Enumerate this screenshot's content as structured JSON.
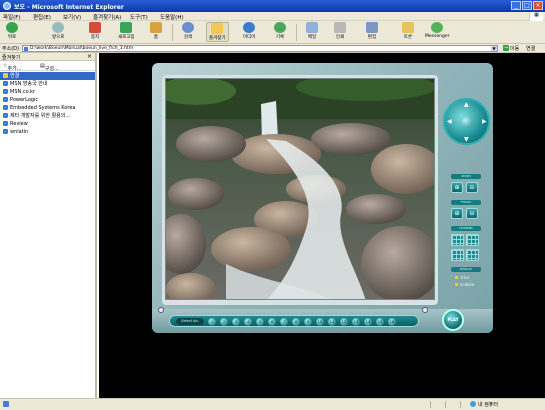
{
  "window": {
    "title": "보오 - Microsoft Internet Explorer"
  },
  "menu": [
    "파일(F)",
    "편집(E)",
    "보기(V)",
    "즐겨찾기(A)",
    "도구(T)",
    "도움말(H)"
  ],
  "toolbar": {
    "buttons": [
      {
        "label": "뒤로",
        "icon": "back-arrow-icon"
      },
      {
        "label": "앞으로",
        "icon": "forward-arrow-icon"
      },
      {
        "label": "중지",
        "icon": "stop-icon"
      },
      {
        "label": "새로고침",
        "icon": "refresh-icon"
      },
      {
        "label": "홈",
        "icon": "home-icon"
      },
      {
        "label": "검색",
        "icon": "search-icon"
      },
      {
        "label": "즐겨찾기",
        "icon": "favorites-star-icon"
      },
      {
        "label": "미디어",
        "icon": "media-icon"
      },
      {
        "label": "기록",
        "icon": "history-icon"
      },
      {
        "label": "메일",
        "icon": "mail-icon"
      },
      {
        "label": "인쇄",
        "icon": "print-icon"
      },
      {
        "label": "편집",
        "icon": "edit-icon"
      },
      {
        "label": "토론",
        "icon": "discuss-icon"
      },
      {
        "label": "Messenger",
        "icon": "messenger-icon"
      }
    ]
  },
  "address": {
    "label": "주소(D)",
    "url": "D:\\work\\Boeun\\Manual\\boeun_live_f\\ch_1.htm",
    "go_label": "이동",
    "links_label": "연결"
  },
  "sidebar": {
    "title": "즐겨찾기",
    "close": "×",
    "add_label": "추가...",
    "organize_label": "구성...",
    "items": [
      {
        "label": "연결",
        "selected": true,
        "folder": true
      },
      {
        "label": "MSN 방송국 안내",
        "selected": false,
        "folder": false
      },
      {
        "label": "MSN.co.kr",
        "selected": false,
        "folder": false
      },
      {
        "label": "PowerLogic",
        "selected": false,
        "folder": false
      },
      {
        "label": "Embedded Systems Korea",
        "selected": false,
        "folder": false
      },
      {
        "label": "제타 개발자를 위한 활용의...",
        "selected": false,
        "folder": false
      },
      {
        "label": "Review",
        "selected": false,
        "folder": false
      },
      {
        "label": "wnlatin",
        "selected": false,
        "folder": false
      }
    ]
  },
  "viewer": {
    "controls": {
      "zoom_label": "ZOOM",
      "focus_label": "FOCUS",
      "channel_label": "CHANNEL",
      "display_label": "DISPLAY",
      "display_items": [
        "TITLE",
        "SCREEN"
      ]
    },
    "select_label": "Select No.",
    "channel_numbers": [
      "1",
      "2",
      "3",
      "4",
      "5",
      "6",
      "7",
      "8",
      "9",
      "10",
      "11",
      "12",
      "13",
      "14",
      "15",
      "16"
    ],
    "play_label": "PLAY"
  },
  "status": {
    "zone": "내 컴퓨터"
  },
  "colors": {
    "title_blue": "#0a3aa8",
    "chrome": "#ece9d8",
    "viewer_teal": "#1f8d92",
    "selected_blue": "#316ac5"
  }
}
